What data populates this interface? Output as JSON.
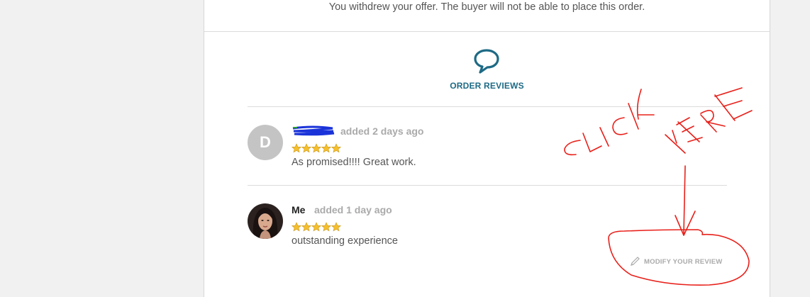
{
  "notice": {
    "text": "You withdrew your offer. The buyer will not be able to place this order."
  },
  "reviews": {
    "title": "ORDER REVIEWS",
    "icon": "speech-bubble-icon",
    "accent_color": "#1d6a85",
    "items": [
      {
        "avatar_letter": "D",
        "name": "",
        "time": "added 2 days ago",
        "rating": 5,
        "text": "As promised!!!! Great work."
      },
      {
        "avatar_letter": "",
        "name": "Me",
        "time": "added 1 day ago",
        "rating": 5,
        "text": "outstanding experience"
      }
    ],
    "modify_label": "MODIFY YOUR REVIEW"
  },
  "annotation": {
    "left_text": "CLICK",
    "right_text": "HERE",
    "color": "#e8201a"
  }
}
